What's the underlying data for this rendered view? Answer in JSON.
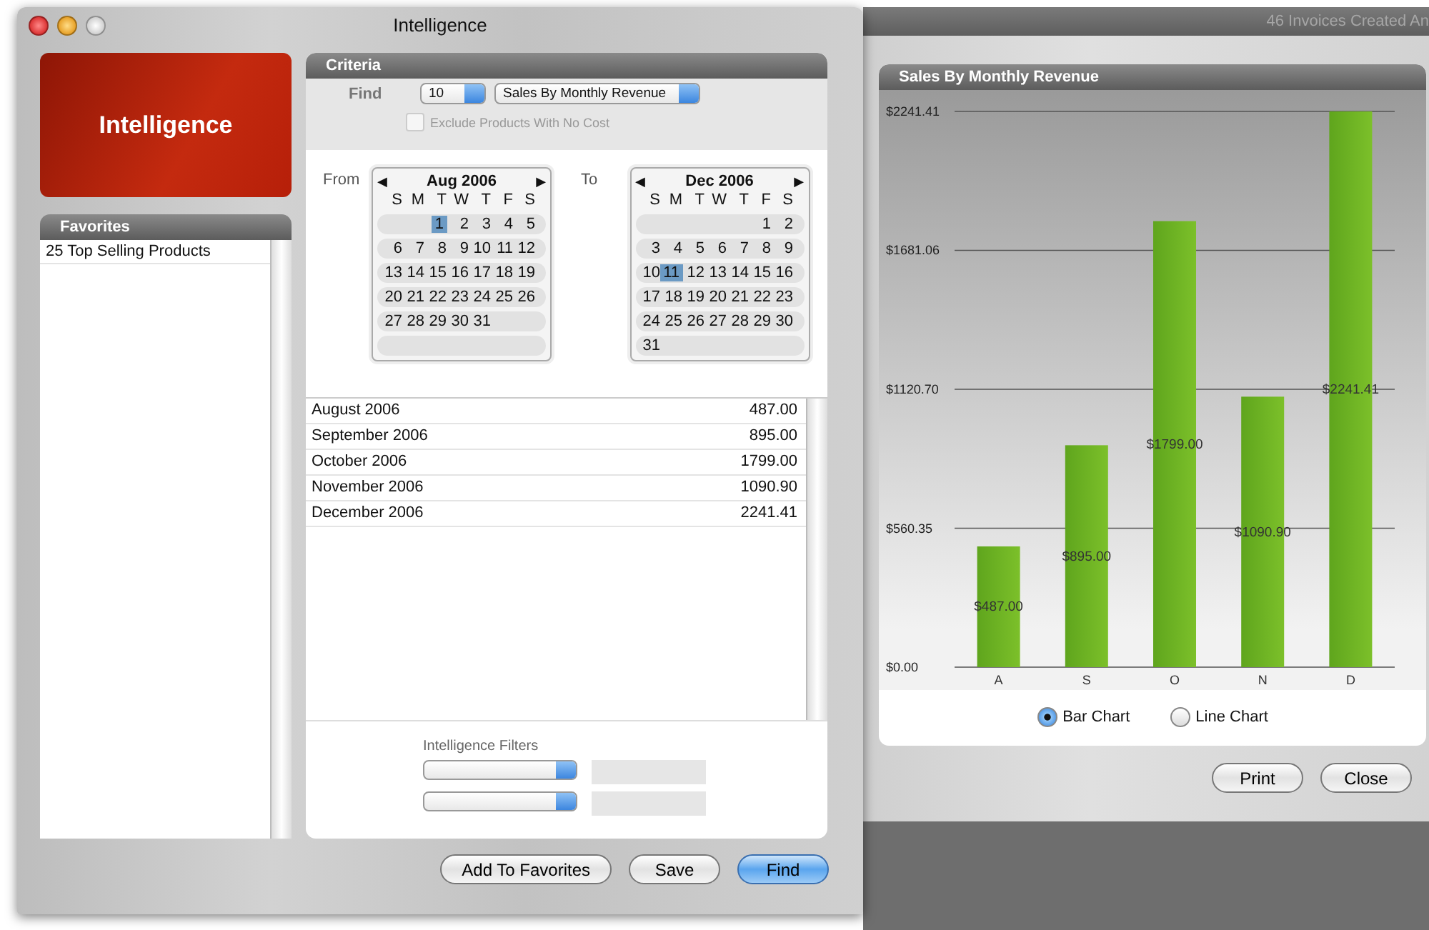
{
  "main_window": {
    "title": "Intelligence",
    "logo_text": "Intelligence"
  },
  "favorites": {
    "title": "Favorites",
    "items": [
      {
        "label": "25 Top Selling Products",
        "selected": false
      }
    ]
  },
  "criteria": {
    "title": "Criteria",
    "find_label": "Find",
    "count": "10",
    "report": "Sales By Monthly Revenue",
    "exclude_checkbox": {
      "label": "Exclude Products With No Cost",
      "checked": false,
      "disabled": true
    }
  },
  "calendars": [
    {
      "label": "From",
      "prev": "◀",
      "next": "▶",
      "month": "Aug 2006",
      "weekdays": [
        "S",
        "M",
        "T",
        "W",
        "T",
        "F",
        "S"
      ],
      "weeks": [
        [
          {
            "d": "1",
            "selected": true
          },
          {
            "d": "2",
            "selected": false
          },
          {
            "d": "3",
            "selected": false
          },
          {
            "d": "4",
            "selected": false
          },
          {
            "d": "5",
            "selected": false
          }
        ],
        [
          {
            "d": "6",
            "selected": false
          },
          {
            "d": "7",
            "selected": false
          },
          {
            "d": "8",
            "selected": false
          },
          {
            "d": "9",
            "selected": false
          },
          {
            "d": "10",
            "selected": false
          },
          {
            "d": "11",
            "selected": false
          },
          {
            "d": "12",
            "selected": false
          }
        ],
        [
          {
            "d": "13",
            "selected": false
          },
          {
            "d": "14",
            "selected": false
          },
          {
            "d": "15",
            "selected": false
          },
          {
            "d": "16",
            "selected": false
          },
          {
            "d": "17",
            "selected": false
          },
          {
            "d": "18",
            "selected": false
          },
          {
            "d": "19",
            "selected": false
          }
        ],
        [
          {
            "d": "20",
            "selected": false
          },
          {
            "d": "21",
            "selected": false
          },
          {
            "d": "22",
            "selected": false
          },
          {
            "d": "23",
            "selected": false
          },
          {
            "d": "24",
            "selected": false
          },
          {
            "d": "25",
            "selected": false
          },
          {
            "d": "26",
            "selected": false
          }
        ],
        [
          {
            "d": "27",
            "selected": false
          },
          {
            "d": "28",
            "selected": false
          },
          {
            "d": "29",
            "selected": false
          },
          {
            "d": "30",
            "selected": false
          },
          {
            "d": "31",
            "selected": false
          }
        ]
      ]
    },
    {
      "label": "To",
      "prev": "◀",
      "next": "▶",
      "month": "Dec 2006",
      "weekdays": [
        "S",
        "M",
        "T",
        "W",
        "T",
        "F",
        "S"
      ],
      "weeks": [
        [
          {
            "d": "1",
            "selected": false
          },
          {
            "d": "2",
            "selected": false
          }
        ],
        [
          {
            "d": "3",
            "selected": false
          },
          {
            "d": "4",
            "selected": false
          },
          {
            "d": "5",
            "selected": false
          },
          {
            "d": "6",
            "selected": false
          },
          {
            "d": "7",
            "selected": false
          },
          {
            "d": "8",
            "selected": false
          },
          {
            "d": "9",
            "selected": false
          }
        ],
        [
          {
            "d": "10",
            "selected": false
          },
          {
            "d": "11",
            "selected": true
          },
          {
            "d": "12",
            "selected": false
          },
          {
            "d": "13",
            "selected": false
          },
          {
            "d": "14",
            "selected": false
          },
          {
            "d": "15",
            "selected": false
          },
          {
            "d": "16",
            "selected": false
          }
        ],
        [
          {
            "d": "17",
            "selected": false
          },
          {
            "d": "18",
            "selected": false
          },
          {
            "d": "19",
            "selected": false
          },
          {
            "d": "20",
            "selected": false
          },
          {
            "d": "21",
            "selected": false
          },
          {
            "d": "22",
            "selected": false
          },
          {
            "d": "23",
            "selected": false
          }
        ],
        [
          {
            "d": "24",
            "selected": false
          },
          {
            "d": "25",
            "selected": false
          },
          {
            "d": "26",
            "selected": false
          },
          {
            "d": "27",
            "selected": false
          },
          {
            "d": "28",
            "selected": false
          },
          {
            "d": "29",
            "selected": false
          },
          {
            "d": "30",
            "selected": false
          }
        ],
        [
          {
            "d": "31",
            "selected": false
          }
        ]
      ]
    }
  ],
  "results": [
    {
      "month": "August 2006",
      "amount": "487.00"
    },
    {
      "month": "September 2006",
      "amount": "895.00"
    },
    {
      "month": "October 2006",
      "amount": "1799.00"
    },
    {
      "month": "November 2006",
      "amount": "1090.90"
    },
    {
      "month": "December 2006",
      "amount": "2241.41"
    }
  ],
  "filters": {
    "label": "Intelligence Filters",
    "rows": [
      {
        "disabled": true
      },
      {
        "disabled": true
      }
    ]
  },
  "buttons": [
    {
      "label": "Add To Favorites",
      "default": false
    },
    {
      "label": "Save",
      "default": false
    },
    {
      "label": "Find",
      "default": true
    }
  ],
  "chart_window": {
    "title": "46 Invoices Created An",
    "panel_title": "Sales By Monthly Revenue",
    "chart_data": {
      "type": "bar",
      "categories": [
        "A",
        "S",
        "O",
        "N",
        "D"
      ],
      "grid": true,
      "series": [
        {
          "color": "#7cc02a",
          "values": [
            487.0,
            895.0,
            1799.0,
            1090.9,
            2241.41
          ]
        }
      ],
      "ylim": [
        0,
        2241.41
      ],
      "yticks": [
        {
          "value": 0,
          "label": "$0.00"
        },
        {
          "value": 560.35,
          "label": "$560.35"
        },
        {
          "value": 1120.7,
          "label": "$1120.70"
        },
        {
          "value": 1681.06,
          "label": "$1681.06"
        },
        {
          "value": 2241.41,
          "label": "$2241.41"
        }
      ],
      "value_labels": [
        "$487.00",
        "$895.00",
        "$1799.00",
        "$1090.90",
        "$2241.41"
      ]
    },
    "chart_types": [
      {
        "label": "Bar Chart",
        "selected": true
      },
      {
        "label": "Line Chart",
        "selected": false
      }
    ],
    "buttons": [
      {
        "label": "Print",
        "default": false
      },
      {
        "label": "Close",
        "default": false
      }
    ]
  }
}
